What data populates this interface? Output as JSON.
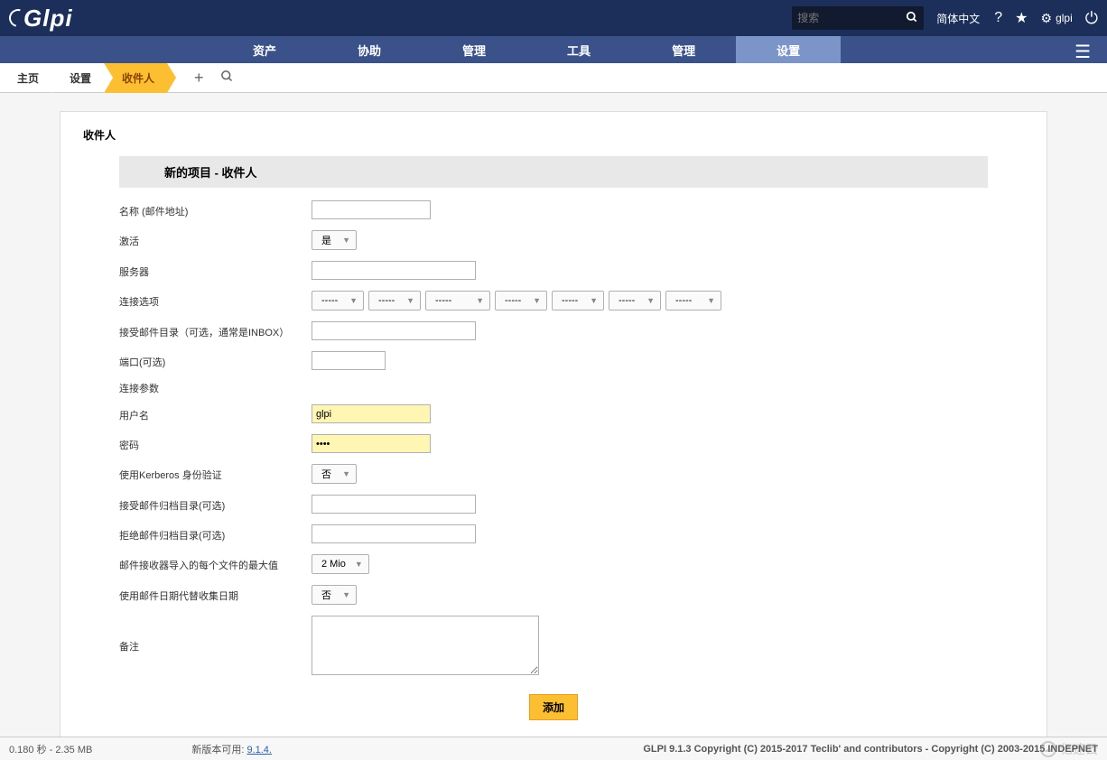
{
  "header": {
    "search_placeholder": "搜索",
    "lang": "简体中文",
    "user": "glpi"
  },
  "nav": {
    "items": [
      "资产",
      "协助",
      "管理",
      "工具",
      "管理",
      "设置"
    ],
    "active_index": 5
  },
  "breadcrumb": {
    "items": [
      "主页",
      "设置",
      "收件人"
    ]
  },
  "page": {
    "title": "收件人",
    "section_title": "新的项目 - 收件人"
  },
  "form": {
    "name_label": "名称 (邮件地址)",
    "name_value": "",
    "activate_label": "激活",
    "activate_value": "是",
    "server_label": "服务器",
    "server_value": "",
    "conn_opt_label": "连接选项",
    "conn_opt_value": "-----",
    "inbox_label": "接受邮件目录（可选，通常是INBOX）",
    "inbox_value": "",
    "port_label": "端口(可选)",
    "port_value": "",
    "params_label": "连接参数",
    "user_label": "用户名",
    "user_value": "glpi",
    "pass_label": "密码",
    "pass_value": "••••",
    "kerberos_label": "使用Kerberos 身份验证",
    "kerberos_value": "否",
    "archive_accept_label": "接受邮件归档目录(可选)",
    "archive_accept_value": "",
    "archive_reject_label": "拒绝邮件归档目录(可选)",
    "archive_reject_value": "",
    "maxsize_label": "邮件接收器导入的每个文件的最大值",
    "maxsize_value": "2 Mio",
    "maildate_label": "使用邮件日期代替收集日期",
    "maildate_value": "否",
    "remark_label": "备注",
    "remark_value": "",
    "submit_label": "添加"
  },
  "footer": {
    "perf": "0.180 秒 - 2.35 MB",
    "newver_label": "新版本可用: ",
    "newver_link": "9.1.4.",
    "copyright": "GLPI 9.1.3 Copyright (C) 2015-2017 Teclib' and contributors - Copyright (C) 2003-2015 INDEPNET",
    "watermark": "亿速云"
  }
}
